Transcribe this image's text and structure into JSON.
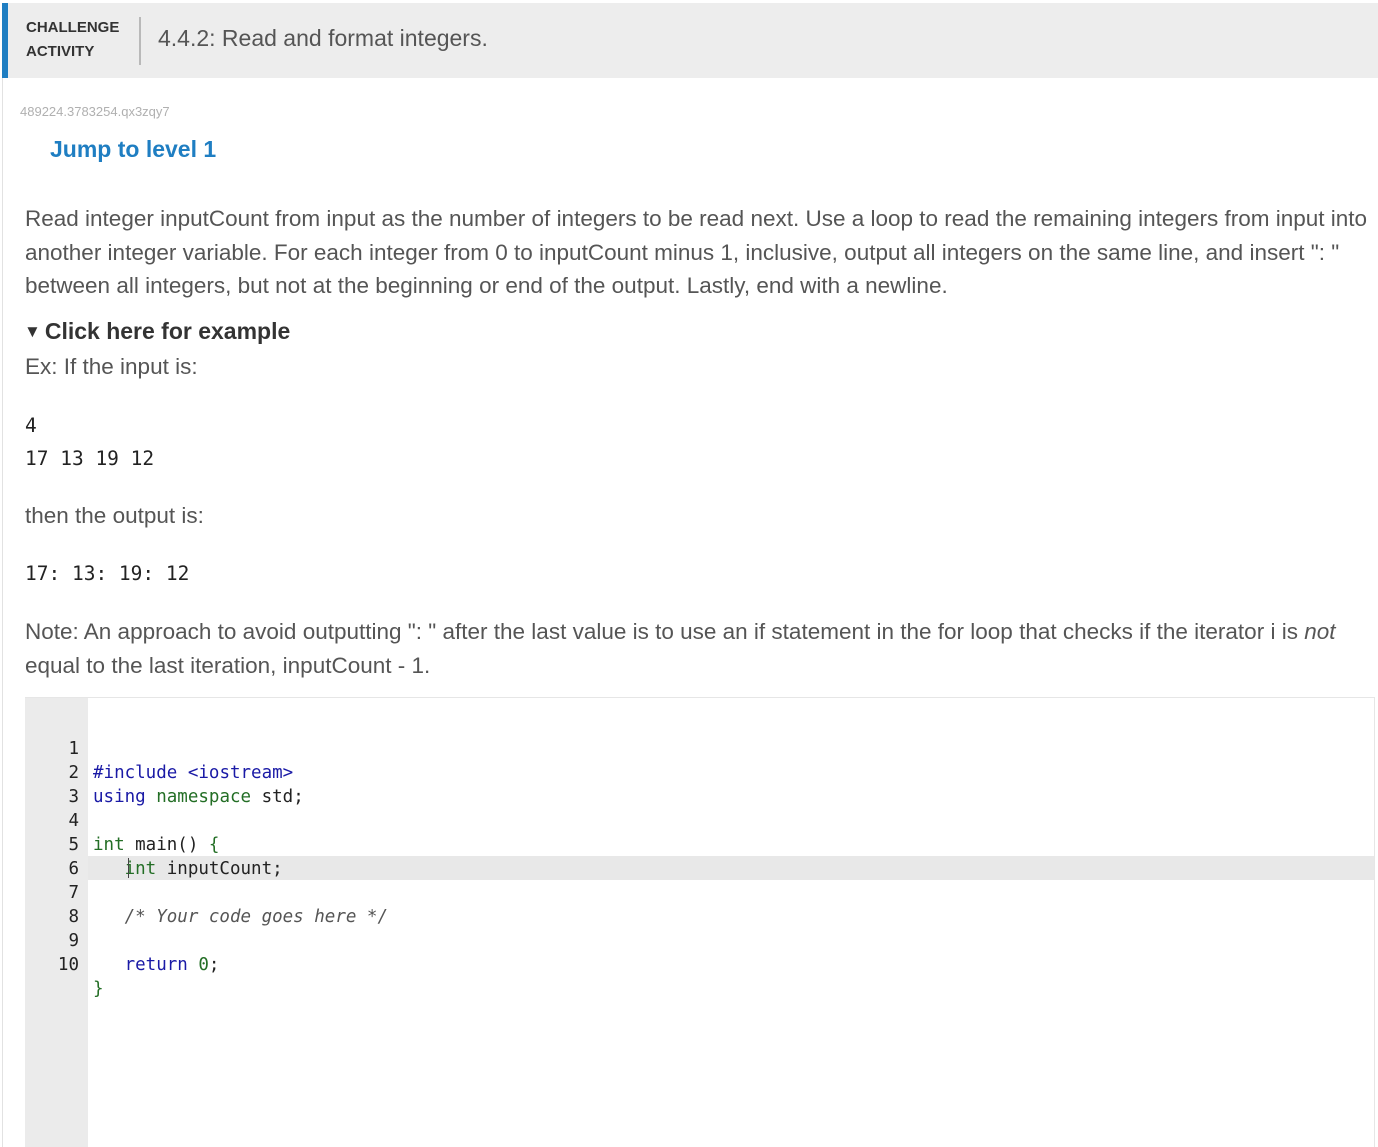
{
  "header": {
    "challenge_label": "CHALLENGE ACTIVITY",
    "title": "4.4.2: Read and format integers."
  },
  "activity_id": "489224.3783254.qx3zqy7",
  "jump_link": "Jump to level 1",
  "instructions": "Read integer inputCount from input as the number of integers to be read next. Use a loop to read the remaining integers from input into another integer variable. For each integer from 0 to inputCount minus 1, inclusive, output all integers on the same line, and insert \": \" between all integers, but not at the beginning or end of the output. Lastly, end with a newline.",
  "example": {
    "toggle_label": "Click here for example",
    "input_intro": "Ex: If the input is:",
    "input_lines": [
      "4",
      "17 13 19 12"
    ],
    "output_intro": "then the output is:",
    "output_line": "17: 13: 19: 12"
  },
  "note": {
    "before": "Note: An approach to avoid outputting \": \" after the last value is to use an if statement in the for loop that checks if the iterator i is ",
    "emphasis": "not",
    "after": " equal to the last iteration, inputCount - 1."
  },
  "editor": {
    "lines": [
      {
        "num": "1",
        "text": "#include <iostream>"
      },
      {
        "num": "2",
        "text": "using namespace std;"
      },
      {
        "num": "3",
        "text": ""
      },
      {
        "num": "4",
        "text": "int main() {"
      },
      {
        "num": "5",
        "text": "   int inputCount;"
      },
      {
        "num": "6",
        "text": ""
      },
      {
        "num": "7",
        "text": "   /* Your code goes here */"
      },
      {
        "num": "8",
        "text": ""
      },
      {
        "num": "9",
        "text": "   return 0;"
      },
      {
        "num": "10",
        "text": "}"
      }
    ]
  },
  "colors": {
    "accent": "#1f7ec2",
    "keyword": "#1a1aa6",
    "namespace": "#236e25"
  }
}
